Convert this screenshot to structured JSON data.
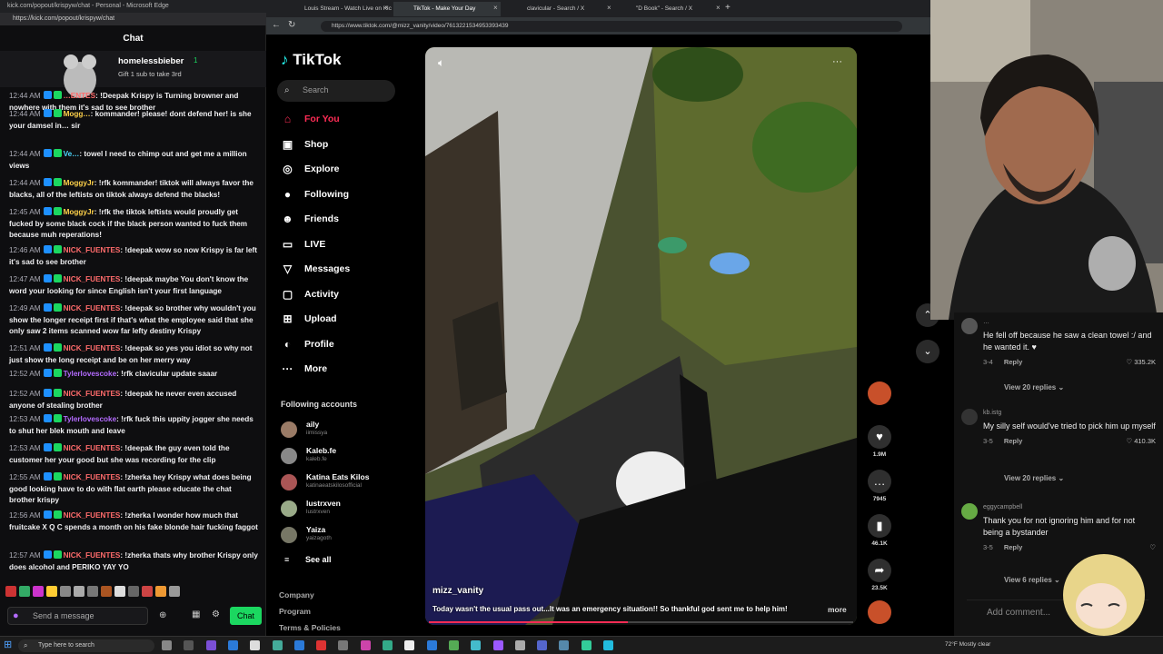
{
  "chat_window": {
    "title": "kick.com/popout/krispyw/chat - Personal - Microsoft Edge",
    "url": "https://kick.com/popout/krispyw/chat",
    "header": "Chat",
    "pinned": {
      "user": "homelessbieber",
      "count": "1",
      "text": "Gift 1 sub to take 3rd"
    },
    "messages": [
      {
        "time": "12:44 AM",
        "user": "…ENTES",
        "cls": "u3",
        "text": "!Deepak Krispy is Turning browner and nowhere with them it's sad to see brother"
      },
      {
        "time": "12:44 AM",
        "user": "Mogg…",
        "cls": "u2",
        "text": "kommander! please! dont defend her! is she your damsel in… sir"
      },
      {
        "time": "12:44 AM",
        "user": "Ve…",
        "cls": "u5",
        "text": "towel I need to chimp out and get me a million views"
      },
      {
        "time": "12:44 AM",
        "user": "MoggyJr",
        "cls": "u2",
        "text": "!rfk kommander! tiktok will always favor the blacks, all of the leftists on tiktok always defend the blacks!"
      },
      {
        "time": "12:45 AM",
        "user": "MoggyJr",
        "cls": "u2",
        "text": "!rfk the tiktok leftists would proudly get fucked by some black cock if the black person wanted to fuck them because muh reperations!"
      },
      {
        "time": "12:46 AM",
        "user": "NICK_FUENTES",
        "cls": "u3",
        "text": "!deepak wow so now Krispy is far left it's sad to see brother"
      },
      {
        "time": "12:47 AM",
        "user": "NICK_FUENTES",
        "cls": "u3",
        "text": "!deepak maybe You don't know the word your looking for since English isn't your first language"
      },
      {
        "time": "12:49 AM",
        "user": "NICK_FUENTES",
        "cls": "u3",
        "text": "!deepak so brother why wouldn't you show the longer receipt first if that's what the employee said that she only saw 2 items scanned wow far lefty destiny Krispy"
      },
      {
        "time": "12:51 AM",
        "user": "NICK_FUENTES",
        "cls": "u3",
        "text": "!deepak so yes you idiot so why not just show the long receipt and be on her merry way"
      },
      {
        "time": "12:52 AM",
        "user": "Tylerlovescoke",
        "cls": "u4",
        "text": "!rfk clavicular update saaar"
      },
      {
        "time": "12:52 AM",
        "user": "NICK_FUENTES",
        "cls": "u3",
        "text": "!deepak he never even accused anyone of stealing brother"
      },
      {
        "time": "12:53 AM",
        "user": "Tylerlovescoke",
        "cls": "u4",
        "text": "!rfk fuck this uppity jogger she needs to shut her blek mouth and leave"
      },
      {
        "time": "12:53 AM",
        "user": "NICK_FUENTES",
        "cls": "u3",
        "text": "!deepak the guy even told the customer her your good but she was recording for the clip"
      },
      {
        "time": "12:55 AM",
        "user": "NICK_FUENTES",
        "cls": "u3",
        "text": "!zherka hey Krispy what does being good looking have to do with flat earth please educate the chat brother krispy"
      },
      {
        "time": "12:56 AM",
        "user": "NICK_FUENTES",
        "cls": "u3",
        "text": "!zherka I wonder how much that fruitcake X Q C spends a month on his fake blonde hair fucking faggot"
      },
      {
        "time": "12:57 AM",
        "user": "NICK_FUENTES",
        "cls": "u3",
        "text": "!zherka thats why brother Krispy only does alcohol and PERIKO YAY YO"
      }
    ],
    "input_placeholder": "Send a message",
    "chat_button": "Chat"
  },
  "browser": {
    "tabs": [
      {
        "label": "Louis Stream - Watch Live on Kick",
        "active": false
      },
      {
        "label": "TikTok - Make Your Day",
        "active": true
      },
      {
        "label": "clavicular - Search / X",
        "active": false
      },
      {
        "label": "\"D Book\" - Search / X",
        "active": false
      }
    ],
    "url": "https://www.tiktok.com/@mizz_vanity/video/7613221534953393439"
  },
  "tiktok": {
    "logo": "TikTok",
    "search_placeholder": "Search",
    "nav": [
      {
        "label": "For You",
        "icon": "home-icon",
        "glyph": "⌂",
        "active": true
      },
      {
        "label": "Shop",
        "icon": "shop-icon",
        "glyph": "▣"
      },
      {
        "label": "Explore",
        "icon": "compass-icon",
        "glyph": "◎"
      },
      {
        "label": "Following",
        "icon": "following-icon",
        "glyph": "●"
      },
      {
        "label": "Friends",
        "icon": "friends-icon",
        "glyph": "☻"
      },
      {
        "label": "LIVE",
        "icon": "live-icon",
        "glyph": "▭"
      },
      {
        "label": "Messages",
        "icon": "messages-icon",
        "glyph": "▽"
      },
      {
        "label": "Activity",
        "icon": "activity-icon",
        "glyph": "▢"
      },
      {
        "label": "Upload",
        "icon": "upload-icon",
        "glyph": "⊞"
      },
      {
        "label": "Profile",
        "icon": "profile-icon",
        "glyph": "◐"
      },
      {
        "label": "More",
        "icon": "more-icon",
        "glyph": "···"
      }
    ],
    "following_header": "Following accounts",
    "accounts": [
      {
        "name": "aily",
        "handle": "iimissya"
      },
      {
        "name": "Kaleb.fe",
        "handle": "kaleb.fe"
      },
      {
        "name": "Katina Eats Kilos",
        "handle": "katinaeatskilosofficial"
      },
      {
        "name": "lustrxven",
        "handle": "lustrxven"
      },
      {
        "name": "Yaiza",
        "handle": "yaizagoth"
      }
    ],
    "see_all": "See all",
    "footer": [
      "Company",
      "Program",
      "Terms & Policies"
    ],
    "video": {
      "author": "mizz_vanity",
      "caption": "Today wasn't the usual pass out...It was an emergency situation!! So thankful god sent me to help him!",
      "more": "more",
      "progress": 0.47
    },
    "actions": {
      "likes": "1.9M",
      "comments": "7945",
      "saves": "46.1K",
      "shares": "23.5K"
    },
    "comments": [
      {
        "user": "…",
        "text": "He fell off because he saw a clean towel :/ and he wanted it. ♥",
        "date": "3-4",
        "likes": "335.2K",
        "replies": "View 20 replies"
      },
      {
        "user": "kb.istg",
        "text": "My silly self would've tried to pick him up myself",
        "date": "3-5",
        "likes": "410.3K",
        "replies": "View 20 replies"
      },
      {
        "user": "eggycampbell",
        "text": "Thank you for not ignoring him and for not being a bystander",
        "date": "3-5",
        "likes": "",
        "replies": "View 6 replies"
      }
    ],
    "reply_label": "Reply",
    "add_comment": "Add comment..."
  },
  "taskbar": {
    "search": "Type here to search",
    "weather": "72°F  Mostly clear"
  }
}
